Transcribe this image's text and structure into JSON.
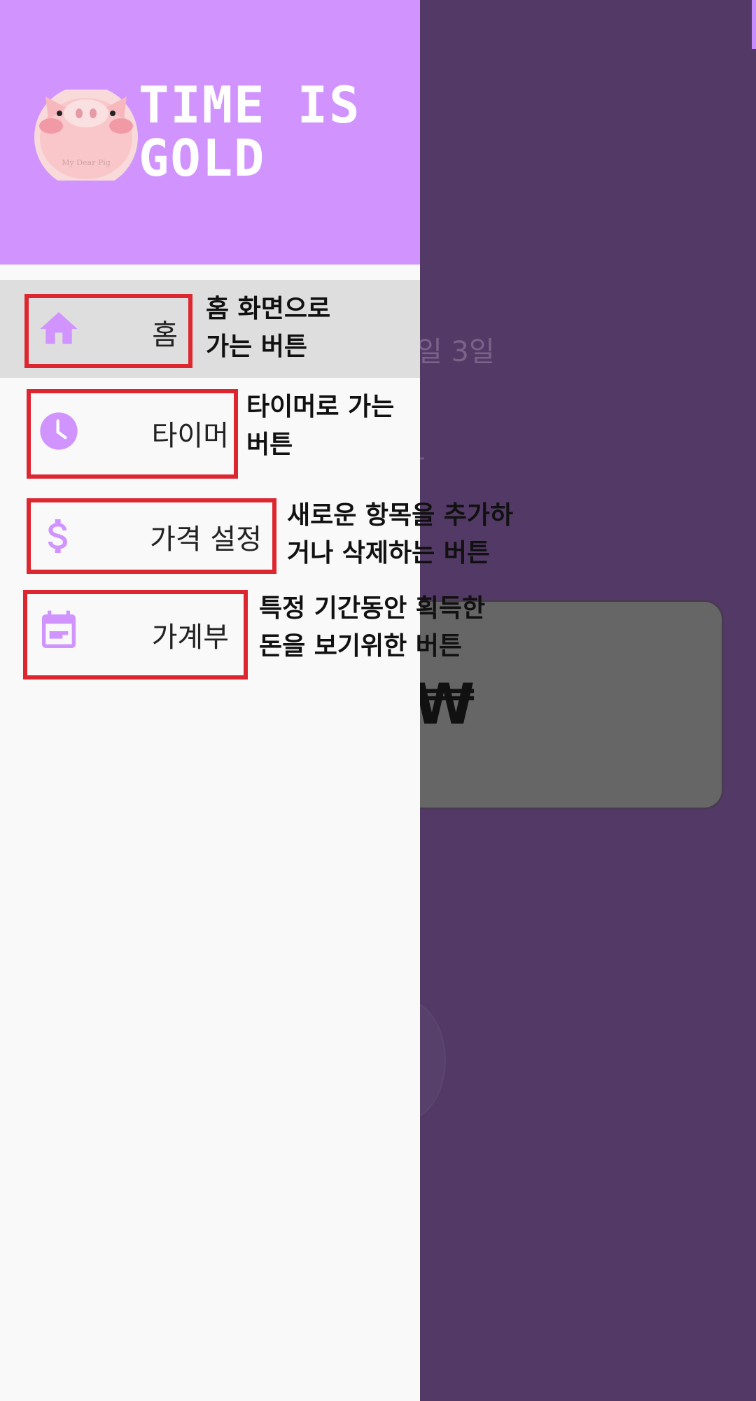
{
  "background": {
    "date_text": "일 3일",
    "won_symbol": "₩"
  },
  "drawer": {
    "brand_line1": "TIME IS",
    "brand_line2": "GOLD",
    "logo_caption": "My Dear Pig",
    "items": [
      {
        "label": "홈",
        "icon": "home-icon"
      },
      {
        "label": "타이머",
        "icon": "clock-icon"
      },
      {
        "label": "가격 설정",
        "icon": "dollar-icon"
      },
      {
        "label": "가계부",
        "icon": "calendar-note-icon"
      }
    ]
  },
  "annotations": [
    {
      "line1": "홈 화면으로",
      "line2": "가는 버튼"
    },
    {
      "line1": "타이머로 가는",
      "line2": "버튼"
    },
    {
      "line1": "새로운 항목을 추가하",
      "line2": "거나 삭제하는 버튼"
    },
    {
      "line1": "특정 기간동안 획득한",
      "line2": "돈을 보기위한 버튼"
    }
  ],
  "colors": {
    "accent": "#d194ff",
    "scrim": "#533a66",
    "annotation_red": "#dc2630",
    "active_item_bg": "#dedede"
  }
}
